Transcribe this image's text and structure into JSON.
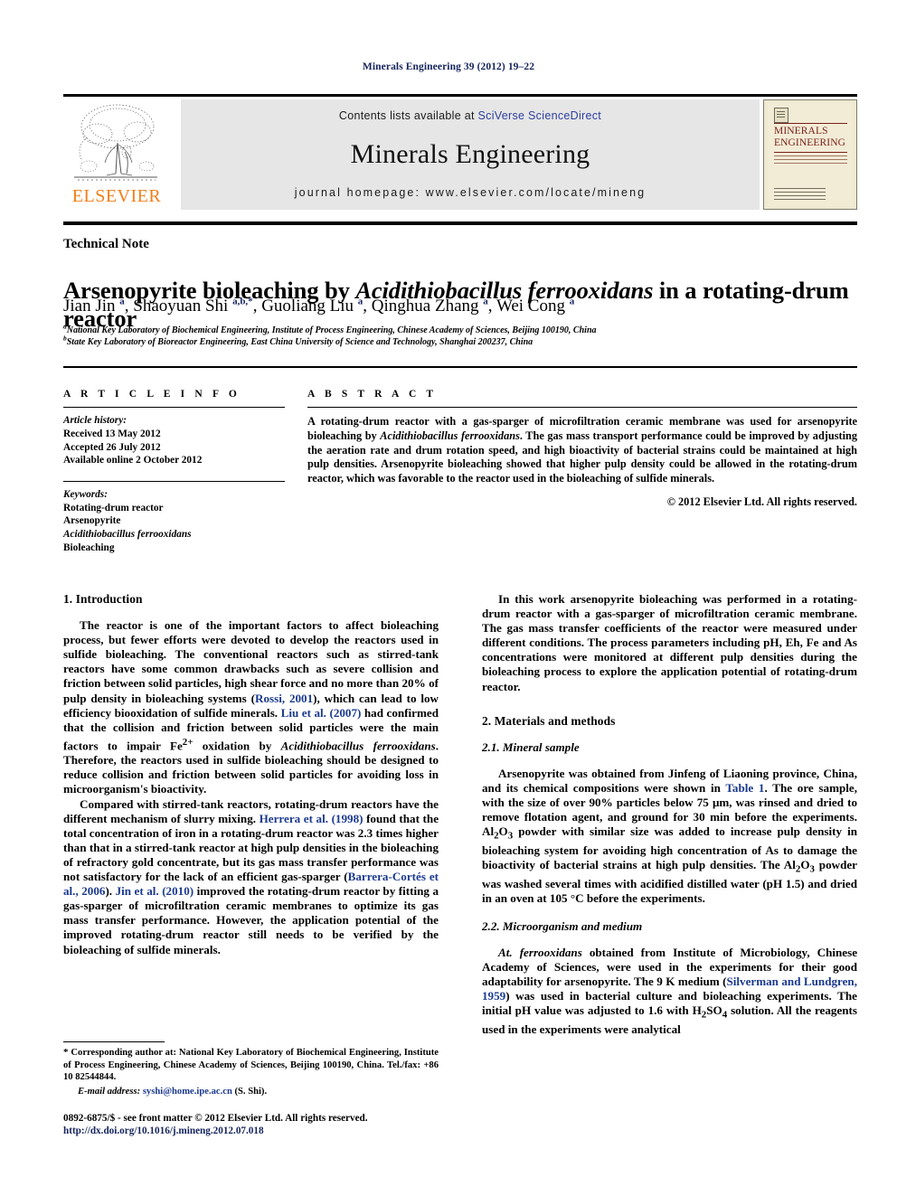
{
  "running_head": "Minerals Engineering 39 (2012) 19–22",
  "masthead": {
    "contents_prefix": "Contents lists available at ",
    "contents_link": "SciVerse ScienceDirect",
    "journal_title": "Minerals Engineering",
    "homepage": "journal homepage: www.elsevier.com/locate/mineng",
    "publisher_wordmark": "ELSEVIER",
    "cover": {
      "line1": "MINERALS",
      "line2": "ENGINEERING"
    }
  },
  "article": {
    "doctype": "Technical Note",
    "title_part1": "Arsenopyrite bioleaching by ",
    "title_italic": "Acidithiobacillus ferrooxidans",
    "title_part2": " in a rotating-drum reactor",
    "authors_html": "Jian Jin <sup>a</sup>, Shaoyuan Shi <sup>a,b,*</sup>, Guoliang Liu <sup>a</sup>, Qinghua Zhang <sup>a</sup>, Wei Cong <sup>a</sup>",
    "affiliation_a": "National Key Laboratory of Biochemical Engineering, Institute of Process Engineering, Chinese Academy of Sciences, Beijing 100190, China",
    "affiliation_b": "State Key Laboratory of Bioreactor Engineering, East China University of Science and Technology, Shanghai 200237, China",
    "affiliation_a_mark": "a",
    "affiliation_b_mark": "b"
  },
  "article_info": {
    "heading": "A R T I C L E    I N F O",
    "history_label": "Article history:",
    "received": "Received 13 May 2012",
    "accepted": "Accepted 26 July 2012",
    "available": "Available online 2 October 2012",
    "keywords_label": "Keywords:",
    "keywords": [
      "Rotating-drum reactor",
      "Arsenopyrite",
      "Acidithiobacillus ferrooxidans",
      "Bioleaching"
    ]
  },
  "abstract": {
    "heading": "A B S T R A C T",
    "text_part1": "A rotating-drum reactor with a gas-sparger of microfiltration ceramic membrane was used for arsenopyrite bioleaching by ",
    "text_italic": "Acidithiobacillus ferrooxidans",
    "text_part2": ". The gas mass transport performance could be improved by adjusting the aeration rate and drum rotation speed, and high bioactivity of bacterial strains could be maintained at high pulp densities. Arsenopyrite bioleaching showed that higher pulp density could be allowed in the rotating-drum reactor, which was favorable to the reactor used in the bioleaching of sulfide minerals.",
    "copyright": "© 2012 Elsevier Ltd. All rights reserved."
  },
  "sections": {
    "introduction_heading": "1. Introduction",
    "intro_p1_a": "The reactor is one of the important factors to affect bioleaching process, but fewer efforts were devoted to develop the reactors used in sulfide bioleaching. The conventional reactors such as stirred-tank reactors have some common drawbacks such as severe collision and friction between solid particles, high shear force and no more than 20% of pulp density in bioleaching systems (",
    "intro_ref1": "Rossi, 2001",
    "intro_p1_b": "), which can lead to low efficiency biooxidation of sulfide minerals. ",
    "intro_ref2": "Liu et al. (2007)",
    "intro_p1_c": " had confirmed that the collision and friction between solid particles were the main factors to impair Fe",
    "intro_p1_sup": "2+",
    "intro_p1_d": " oxidation by ",
    "intro_p1_italic": "Acidithiobacillus ferrooxidans",
    "intro_p1_e": ". Therefore, the reactors used in sulfide bioleaching should be designed to reduce collision and friction between solid particles for avoiding loss in microorganism's bioactivity.",
    "intro_p2_a": "Compared with stirred-tank reactors, rotating-drum reactors have the different mechanism of slurry mixing. ",
    "intro_p2_ref1": "Herrera et al. (1998)",
    "intro_p2_b": " found that the total concentration of iron in a rotating-drum reactor was 2.3 times higher than that in a stirred-tank reactor at high pulp densities in the bioleaching of refractory gold concentrate, but its gas mass transfer performance was not satisfactory for the lack of an efficient gas-sparger (",
    "intro_p2_ref2": "Barrera-Cortés et al., 2006",
    "intro_p2_c": "). ",
    "intro_p2_ref3": "Jin et al. (2010)",
    "intro_p2_d": " improved the rotating-drum reactor by fitting a gas-sparger of microfiltration ceramic membranes to optimize its gas mass transfer performance. However, the application potential of the improved rotating-drum reactor still needs to be verified by the bioleaching of sulfide minerals.",
    "right_p1": "In this work arsenopyrite bioleaching was performed in a rotating-drum reactor with a gas-sparger of microfiltration ceramic membrane. The gas mass transfer coefficients of the reactor were measured under different conditions. The process parameters including pH, Eh, Fe and As concentrations were monitored at different pulp densities during the bioleaching process to explore the application potential of rotating-drum reactor.",
    "materials_heading": "2. Materials and methods",
    "mineral_heading": "2.1. Mineral sample",
    "mineral_p_a": "Arsenopyrite was obtained from Jinfeng of Liaoning province, China, and its chemical compositions were shown in ",
    "mineral_ref": "Table 1",
    "mineral_p_b": ". The ore sample, with the size of over 90% particles below 75 μm, was rinsed and dried to remove flotation agent, and ground for 30 min before the experiments. Al",
    "mineral_sub1": "2",
    "mineral_p_c": "O",
    "mineral_sub2": "3",
    "mineral_p_d": " powder with similar size was added to increase pulp density in bioleaching system for avoiding high concentration of As to damage the bioactivity of bacterial strains at high pulp densities. The Al",
    "mineral_p_e": " powder was washed several times with acidified distilled water (pH 1.5) and dried in an oven at 105 °C before the experiments.",
    "micro_heading": "2.2. Microorganism and medium",
    "micro_p_italic": "At. ferrooxidans",
    "micro_p_a": " obtained from Institute of Microbiology, Chinese Academy of Sciences, were used in the experiments for their good adaptability for arsenopyrite. The 9 K medium (",
    "micro_ref": "Silverman and Lundgren, 1959",
    "micro_p_b": ") was used in bacterial culture and bioleaching experiments. The initial pH value was adjusted to 1.6 with H",
    "micro_sub1": "2",
    "micro_p_c": "SO",
    "micro_sub2": "4",
    "micro_p_d": " solution. All the reagents used in the experiments were analytical"
  },
  "footnote": {
    "star": "*",
    "corresponding": " Corresponding author at: National Key Laboratory of Biochemical Engineering, Institute of Process Engineering, Chinese Academy of Sciences, Beijing 100190, China. Tel./fax: +86 10 82544844.",
    "email_label": "E-mail address:",
    "email": "syshi@home.ipe.ac.cn",
    "email_suffix": " (S. Shi)."
  },
  "imprint": {
    "line1": "0892-6875/$ - see front matter © 2012 Elsevier Ltd. All rights reserved.",
    "doi": "http://dx.doi.org/10.1016/j.mineng.2012.07.018"
  },
  "colors": {
    "link_blue": "#1b3a8f",
    "navy": "#14235c",
    "elsevier_orange": "#f07f1a",
    "masthead_gray": "#e6e6e6",
    "cover_cream": "#f2ecd7",
    "cover_red": "#7a2018"
  }
}
